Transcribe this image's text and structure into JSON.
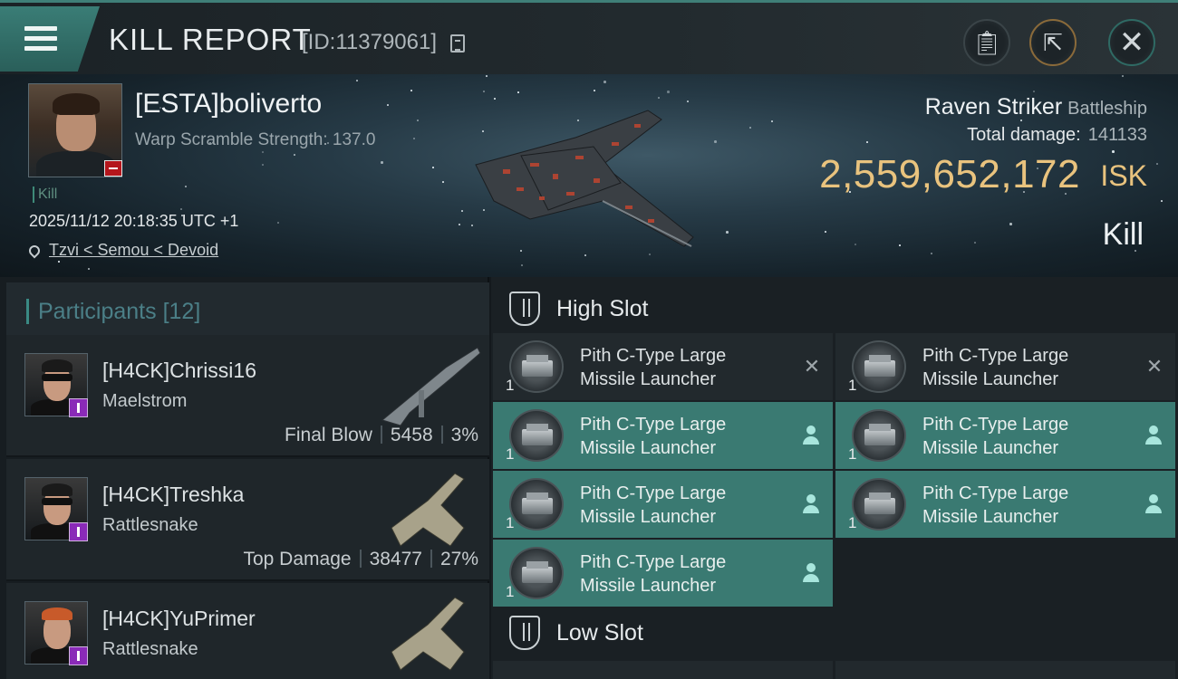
{
  "header": {
    "title": "KILL REPORT",
    "report_id": "[ID:11379061]"
  },
  "victim": {
    "name": "[ESTA]boliverto",
    "warp_scramble": "Warp Scramble Strength: 137.0",
    "kill_tag": "Kill",
    "datetime": "2025/11/12 20:18:35 UTC +1",
    "location": "Tzvi < Semou < Devoid",
    "ship_name": "Raven Striker",
    "ship_class": "Battleship",
    "total_damage_label": "Total damage:",
    "total_damage": "141133",
    "isk_value": "2,559,652,172",
    "isk_unit": "ISK",
    "result": "Kill"
  },
  "participants": {
    "label": "Participants",
    "count": "[12]",
    "items": [
      {
        "name": "[H4CK]Chrissi16",
        "ship": "Maelstrom",
        "role": "Final Blow",
        "damage": "5458",
        "percent": "3%"
      },
      {
        "name": "[H4CK]Treshka",
        "ship": "Rattlesnake",
        "role": "Top Damage",
        "damage": "38477",
        "percent": "27%"
      },
      {
        "name": "[H4CK]YuPrimer",
        "ship": "Rattlesnake",
        "role": "",
        "damage": "",
        "percent": ""
      }
    ]
  },
  "fitting": {
    "high_slot_label": "High Slot",
    "low_slot_label": "Low Slot",
    "high_modules": [
      {
        "name": "Pith C-Type Large\nMissile Launcher",
        "qty": "1",
        "state": "destroyed"
      },
      {
        "name": "Pith C-Type Large\nMissile Launcher",
        "qty": "1",
        "state": "destroyed"
      },
      {
        "name": "Pith C-Type Large\nMissile Launcher",
        "qty": "1",
        "state": "dropped"
      },
      {
        "name": "Pith C-Type Large\nMissile Launcher",
        "qty": "1",
        "state": "dropped"
      },
      {
        "name": "Pith C-Type Large\nMissile Launcher",
        "qty": "1",
        "state": "dropped"
      },
      {
        "name": "Pith C-Type Large\nMissile Launcher",
        "qty": "1",
        "state": "dropped"
      },
      {
        "name": "Pith C-Type Large\nMissile Launcher",
        "qty": "1",
        "state": "dropped"
      }
    ]
  },
  "colors": {
    "accent_teal": "#3a7a72",
    "isk_gold": "#e9c37e",
    "loss_red": "#b4161c",
    "corp_purple": "#8a2ab8"
  },
  "icons": [
    "menu-icon",
    "copy-icon",
    "clipboard-icon",
    "share-icon",
    "close-icon",
    "location-pin-icon",
    "high-slot-icon",
    "low-slot-icon",
    "pilot-icon",
    "destroyed-x-icon"
  ]
}
